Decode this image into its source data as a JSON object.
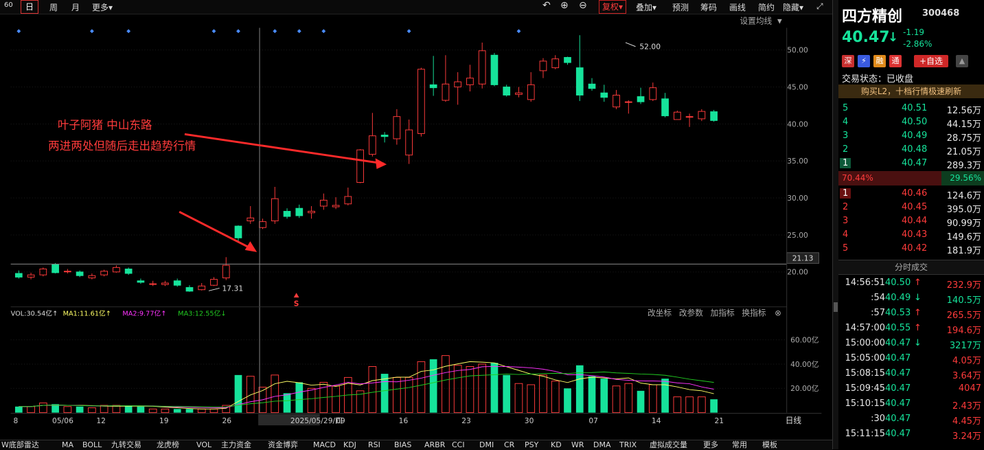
{
  "toolbar": {
    "period_small": "60",
    "day": "日",
    "week": "周",
    "month": "月",
    "more": "更多",
    "fuquan": "复权",
    "overlay": "叠加",
    "forecast": "预测",
    "chips": "筹码",
    "draw": "画线",
    "simple": "简约",
    "hide": "隐藏"
  },
  "chart": {
    "set_ma": "设置均线",
    "price_axis": [
      "50.00",
      "45.00",
      "40.00",
      "35.00",
      "30.00",
      "25.00",
      "20.00"
    ],
    "crosshair_price": "21.13",
    "high_label": "52.00",
    "low_label": "17.31",
    "annotation_line1": "叶子阿猪 中山东路",
    "annotation_line2": "两进两处但随后走出趋势行情",
    "sell_marker": "S",
    "vol_legend": {
      "vol": "VOL:30.54亿↑",
      "ma1": "MA1:11.61亿↑",
      "ma2": "MA2:9.77亿↑",
      "ma3": "MA3:12.55亿↓"
    },
    "vol_buttons": [
      "改坐标",
      "改参数",
      "加指标",
      "换指标"
    ],
    "vol_axis": [
      "60.00亿",
      "40.00亿",
      "20.00亿"
    ],
    "date_axis": [
      "8",
      "05/06",
      "12",
      "19",
      "26",
      "2025/05/29/四",
      "09",
      "16",
      "23",
      "30",
      "07",
      "14",
      "21"
    ],
    "date_axis_right": "日线",
    "colors": {
      "up": "#ff3b3b",
      "down": "#16e39b",
      "ma1": "#ffff66",
      "ma2": "#ff33ff",
      "ma3": "#22cc22"
    }
  },
  "chart_data": {
    "type": "candlestick",
    "candles": [
      {
        "o": 19.8,
        "c": 19.3,
        "h": 20.2,
        "l": 19.1
      },
      {
        "o": 19.3,
        "c": 19.6,
        "h": 19.9,
        "l": 19.0
      },
      {
        "o": 19.6,
        "c": 20.4,
        "h": 20.6,
        "l": 19.4
      },
      {
        "o": 21.0,
        "c": 19.9,
        "h": 21.2,
        "l": 19.8
      },
      {
        "o": 20.1,
        "c": 20.1,
        "h": 20.4,
        "l": 19.8
      },
      {
        "o": 20.0,
        "c": 19.5,
        "h": 20.2,
        "l": 19.3
      },
      {
        "o": 19.2,
        "c": 19.5,
        "h": 19.8,
        "l": 19.0
      },
      {
        "o": 19.6,
        "c": 20.1,
        "h": 20.3,
        "l": 19.4
      },
      {
        "o": 20.0,
        "c": 20.6,
        "h": 20.9,
        "l": 19.9
      },
      {
        "o": 20.4,
        "c": 19.8,
        "h": 20.6,
        "l": 19.6
      },
      {
        "o": 18.8,
        "c": 18.6,
        "h": 19.1,
        "l": 18.4
      },
      {
        "o": 18.4,
        "c": 18.4,
        "h": 18.8,
        "l": 18.1
      },
      {
        "o": 18.3,
        "c": 18.5,
        "h": 18.8,
        "l": 18.1
      },
      {
        "o": 18.8,
        "c": 18.2,
        "h": 19.1,
        "l": 18.0
      },
      {
        "o": 17.9,
        "c": 17.4,
        "h": 18.2,
        "l": 17.31
      },
      {
        "o": 17.6,
        "c": 18.1,
        "h": 18.5,
        "l": 17.5
      },
      {
        "o": 18.2,
        "c": 19.0,
        "h": 19.3,
        "l": 18.1
      },
      {
        "o": 19.2,
        "c": 20.9,
        "h": 22.0,
        "l": 18.9
      },
      {
        "o": 26.2,
        "c": 24.6,
        "h": 26.3,
        "l": 24.2
      },
      {
        "o": 26.9,
        "c": 27.3,
        "h": 28.9,
        "l": 26.5
      },
      {
        "o": 26.0,
        "c": 26.8,
        "h": 27.2,
        "l": 25.8
      },
      {
        "o": 26.9,
        "c": 29.9,
        "h": 31.5,
        "l": 26.5
      },
      {
        "o": 28.2,
        "c": 27.5,
        "h": 28.6,
        "l": 27.2
      },
      {
        "o": 28.6,
        "c": 27.6,
        "h": 29.1,
        "l": 27.3
      },
      {
        "o": 28.0,
        "c": 28.2,
        "h": 28.9,
        "l": 27.2
      },
      {
        "o": 28.9,
        "c": 29.7,
        "h": 30.6,
        "l": 28.4
      },
      {
        "o": 28.8,
        "c": 29.0,
        "h": 30.1,
        "l": 28.5
      },
      {
        "o": 29.2,
        "c": 30.2,
        "h": 31.4,
        "l": 29.0
      },
      {
        "o": 32.1,
        "c": 36.5,
        "h": 36.6,
        "l": 32.0
      },
      {
        "o": 35.9,
        "c": 38.4,
        "h": 41.5,
        "l": 35.6
      },
      {
        "o": 38.5,
        "c": 38.3,
        "h": 38.9,
        "l": 37.5
      },
      {
        "o": 38.0,
        "c": 41.0,
        "h": 42.0,
        "l": 37.2
      },
      {
        "o": 35.8,
        "c": 39.2,
        "h": 40.6,
        "l": 34.6
      },
      {
        "o": 38.7,
        "c": 47.4,
        "h": 47.6,
        "l": 38.3
      },
      {
        "o": 45.3,
        "c": 44.9,
        "h": 49.2,
        "l": 43.8
      },
      {
        "o": 43.2,
        "c": 45.4,
        "h": 49.3,
        "l": 43.0
      },
      {
        "o": 45.0,
        "c": 45.7,
        "h": 47.0,
        "l": 42.6
      },
      {
        "o": 45.3,
        "c": 46.2,
        "h": 48.0,
        "l": 44.4
      },
      {
        "o": 45.4,
        "c": 49.9,
        "h": 51.0,
        "l": 44.8
      },
      {
        "o": 49.3,
        "c": 45.3,
        "h": 49.6,
        "l": 45.1
      },
      {
        "o": 45.0,
        "c": 43.9,
        "h": 45.3,
        "l": 43.7
      },
      {
        "o": 44.0,
        "c": 44.2,
        "h": 45.0,
        "l": 43.6
      },
      {
        "o": 43.3,
        "c": 45.3,
        "h": 47.0,
        "l": 43.0
      },
      {
        "o": 47.2,
        "c": 48.5,
        "h": 48.9,
        "l": 46.2
      },
      {
        "o": 47.6,
        "c": 48.8,
        "h": 49.3,
        "l": 47.4
      },
      {
        "o": 49.0,
        "c": 48.3,
        "h": 49.1,
        "l": 48.0
      },
      {
        "o": 47.6,
        "c": 43.9,
        "h": 52.0,
        "l": 43.1
      },
      {
        "o": 45.4,
        "c": 44.8,
        "h": 46.2,
        "l": 44.5
      },
      {
        "o": 44.2,
        "c": 43.6,
        "h": 45.3,
        "l": 43.0
      },
      {
        "o": 42.3,
        "c": 43.9,
        "h": 44.6,
        "l": 42.0
      },
      {
        "o": 43.0,
        "c": 43.0,
        "h": 43.2,
        "l": 41.4
      },
      {
        "o": 43.7,
        "c": 43.0,
        "h": 44.9,
        "l": 42.7
      },
      {
        "o": 43.3,
        "c": 44.9,
        "h": 45.6,
        "l": 43.1
      },
      {
        "o": 43.4,
        "c": 41.1,
        "h": 44.2,
        "l": 40.9
      },
      {
        "o": 40.6,
        "c": 41.6,
        "h": 41.8,
        "l": 40.6
      },
      {
        "o": 41.0,
        "c": 41.0,
        "h": 41.4,
        "l": 39.6
      },
      {
        "o": 40.7,
        "c": 41.7,
        "h": 42.0,
        "l": 40.4
      },
      {
        "o": 41.66,
        "c": 40.47,
        "h": 41.9,
        "l": 40.3
      }
    ],
    "volumes": [
      5,
      5,
      8,
      7,
      5,
      5,
      4,
      6,
      6,
      6,
      5,
      3,
      3,
      3,
      3,
      3,
      3,
      6,
      31,
      30,
      21,
      31,
      16,
      25,
      20,
      25,
      22,
      29,
      18,
      38,
      32,
      29,
      29,
      42,
      44,
      47,
      39,
      38,
      40,
      41,
      31,
      24,
      23,
      31,
      26,
      20,
      39,
      30,
      28,
      22,
      24,
      18,
      23,
      28,
      13,
      13,
      13,
      11
    ],
    "ylim": [
      16,
      53
    ],
    "vol_ylim": [
      0,
      75
    ]
  },
  "stock": {
    "name": "四方精创",
    "code": "300468",
    "price": "40.47",
    "arrow": "↓",
    "change": "-1.19",
    "change_pct": "-2.86%",
    "badges": [
      "深",
      "⚡",
      "融",
      "通"
    ],
    "add_watch": "+自选",
    "status_label": "交易状态：已收盘",
    "promo": "购买L2，十档行情极速刷新",
    "asks": [
      {
        "lvl": "5",
        "price": "40.51",
        "vol": "12.56万"
      },
      {
        "lvl": "4",
        "price": "40.50",
        "vol": "44.15万"
      },
      {
        "lvl": "3",
        "price": "40.49",
        "vol": "28.75万"
      },
      {
        "lvl": "2",
        "price": "40.48",
        "vol": "21.05万"
      },
      {
        "lvl": "1",
        "price": "40.47",
        "vol": "289.3万"
      }
    ],
    "ratio_left": "70.44%",
    "ratio_right": "29.56%",
    "bids": [
      {
        "lvl": "1",
        "price": "40.46",
        "vol": "124.6万"
      },
      {
        "lvl": "2",
        "price": "40.45",
        "vol": "395.0万"
      },
      {
        "lvl": "3",
        "price": "40.44",
        "vol": "90.99万"
      },
      {
        "lvl": "4",
        "price": "40.43",
        "vol": "149.6万"
      },
      {
        "lvl": "5",
        "price": "40.42",
        "vol": "181.9万"
      }
    ],
    "ticks_title": "分时成交",
    "ticks": [
      {
        "t": "14:56:51",
        "p": "40.50",
        "a": "↑",
        "v": "232.9万",
        "c": "up"
      },
      {
        "t": ":54",
        "p": "40.49",
        "a": "↓",
        "v": "140.5万",
        "c": "down"
      },
      {
        "t": ":57",
        "p": "40.53",
        "a": "↑",
        "v": "265.5万",
        "c": "up"
      },
      {
        "t": "14:57:00",
        "p": "40.55",
        "a": "↑",
        "v": "194.6万",
        "c": "up"
      },
      {
        "t": "15:00:00",
        "p": "40.47",
        "a": "↓",
        "v": "3217万",
        "c": "down"
      },
      {
        "t": "15:05:00",
        "p": "40.47",
        "a": "",
        "v": "4.05万",
        "c": "up"
      },
      {
        "t": "15:08:15",
        "p": "40.47",
        "a": "",
        "v": "3.64万",
        "c": "up"
      },
      {
        "t": "15:09:45",
        "p": "40.47",
        "a": "",
        "v": "4047",
        "c": "up"
      },
      {
        "t": "15:10:15",
        "p": "40.47",
        "a": "",
        "v": "2.43万",
        "c": "up"
      },
      {
        "t": ":30",
        "p": "40.47",
        "a": "",
        "v": "4.45万",
        "c": "up"
      },
      {
        "t": "15:11:15",
        "p": "40.47",
        "a": "",
        "v": "3.24万",
        "c": "up"
      }
    ]
  },
  "bottom_tabs": [
    "W底部雷达",
    "MA",
    "BOLL",
    "九转交易",
    "龙虎榜",
    "VOL",
    "主力资金",
    "资金博弈",
    "MACD",
    "KDJ",
    "RSI",
    "BIAS",
    "ARBR",
    "CCI",
    "DMI",
    "CR",
    "PSY",
    "KD",
    "WR",
    "DMA",
    "TRIX",
    "虚拟成交量",
    "更多",
    "常用",
    "模板"
  ]
}
